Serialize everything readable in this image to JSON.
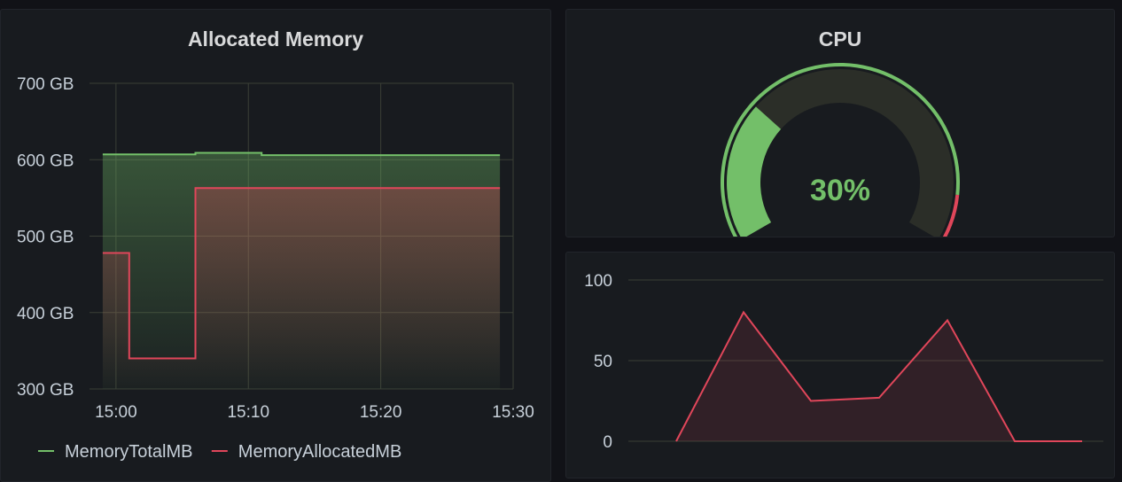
{
  "colors": {
    "background": "#111217",
    "panel": "#181b1f",
    "grid": "#3a3f36",
    "green": "#73bf69",
    "red": "#e0465a",
    "text": "#c7d0d9"
  },
  "memory_panel": {
    "title": "Allocated Memory",
    "legend": [
      {
        "label": "MemoryTotalMB",
        "color": "#73bf69"
      },
      {
        "label": "MemoryAllocatedMB",
        "color": "#e0465a"
      }
    ]
  },
  "gauge_panel": {
    "title": "CPU",
    "value": 30,
    "value_text": "30%",
    "min": 0,
    "max": 100,
    "threshold": 90
  },
  "chart_data": [
    {
      "type": "line",
      "title": "Allocated Memory",
      "x_label": "",
      "y_label": "",
      "x_ticks": [
        "15:00",
        "15:10",
        "15:20",
        "15:30"
      ],
      "y_ticks": [
        "300 GB",
        "400 GB",
        "500 GB",
        "600 GB",
        "700 GB"
      ],
      "xlim": [
        "14:58",
        "15:30"
      ],
      "ylim": [
        300,
        700
      ],
      "y_unit": "GB",
      "grid": true,
      "legend_position": "bottom-left",
      "series": [
        {
          "name": "MemoryTotalMB",
          "color": "#73bf69",
          "x": [
            "14:59",
            "15:06",
            "15:06",
            "15:11",
            "15:11",
            "15:29"
          ],
          "y": [
            607,
            607,
            609,
            609,
            606,
            606
          ]
        },
        {
          "name": "MemoryAllocatedMB",
          "color": "#e0465a",
          "x": [
            "14:59",
            "15:01",
            "15:01",
            "15:06",
            "15:06",
            "15:29"
          ],
          "y": [
            478,
            478,
            340,
            340,
            563,
            563
          ]
        }
      ]
    },
    {
      "type": "area",
      "title": "",
      "y_ticks": [
        "0",
        "50",
        "100"
      ],
      "ylim": [
        0,
        100
      ],
      "grid": true,
      "series": [
        {
          "color": "#e0465a",
          "x": [
            0,
            1,
            2,
            3,
            4,
            5,
            6
          ],
          "y": [
            0,
            80,
            25,
            27,
            75,
            0,
            0
          ]
        }
      ]
    }
  ]
}
